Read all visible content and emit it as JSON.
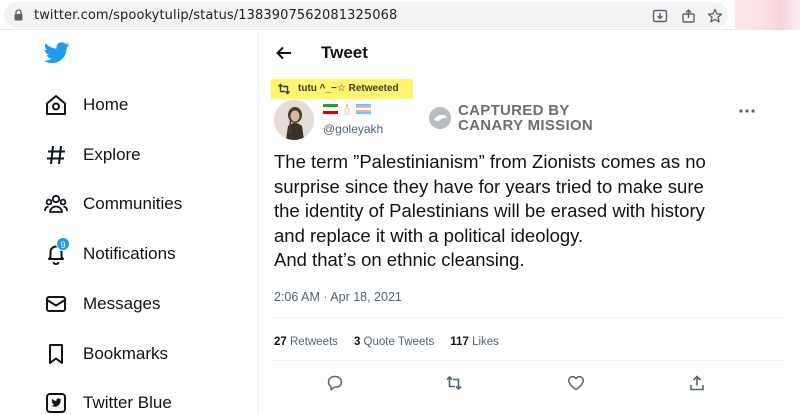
{
  "browser": {
    "url": "twitter.com/spookytulip/status/1383907562081325068"
  },
  "sidebar": {
    "items": [
      {
        "label": "Home",
        "icon": "home-icon"
      },
      {
        "label": "Explore",
        "icon": "hashtag-icon"
      },
      {
        "label": "Communities",
        "icon": "communities-icon"
      },
      {
        "label": "Notifications",
        "icon": "bell-icon",
        "badge": "9"
      },
      {
        "label": "Messages",
        "icon": "envelope-icon"
      },
      {
        "label": "Bookmarks",
        "icon": "bookmark-icon"
      },
      {
        "label": "Twitter Blue",
        "icon": "twitter-blue-icon"
      }
    ]
  },
  "header": {
    "title": "Tweet"
  },
  "tweet": {
    "retweet_label": "tutu ^_−☆ Retweeted",
    "handle": "@goleyakh",
    "watermark_line1": "CAPTURED BY",
    "watermark_line2": "CANARY MISSION",
    "text_lines": [
      "The term ”Palestinianism” from Zionists comes as no",
      "surprise since they have for years tried to make sure",
      "the identity of Palestinians will be erased with history",
      "and replace it with a political ideology.",
      "And that’s on ethnic cleansing."
    ],
    "timestamp": "2:06 AM · Apr 18, 2021",
    "stats": {
      "retweets_count": "27",
      "retweets_label": "Retweets",
      "quotes_count": "3",
      "quotes_label": "Quote Tweets",
      "likes_count": "117",
      "likes_label": "Likes"
    }
  },
  "colors": {
    "accent": "#1d9bf0",
    "highlight": "#fff66e",
    "muted_text": "#536471"
  }
}
